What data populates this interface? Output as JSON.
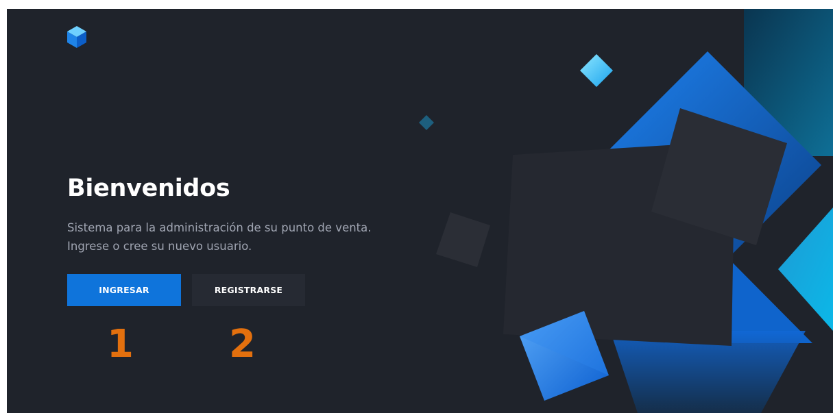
{
  "hero": {
    "title": "Bienvenidos",
    "subtitle_line1": "Sistema para la administración de su punto de venta.",
    "subtitle_line2": "Ingrese o cree su nuevo usuario."
  },
  "buttons": {
    "login_label": "INGRESAR",
    "register_label": "REGISTRARSE"
  },
  "annotations": [
    "1",
    "2"
  ],
  "icons": {
    "logo": "cube-logo-icon"
  },
  "colors": {
    "background": "#1f232b",
    "primary_button": "#0f74db",
    "secondary_button": "#262a33",
    "annotation": "#e3700e",
    "accent_cyan": "#4fd1ff"
  }
}
